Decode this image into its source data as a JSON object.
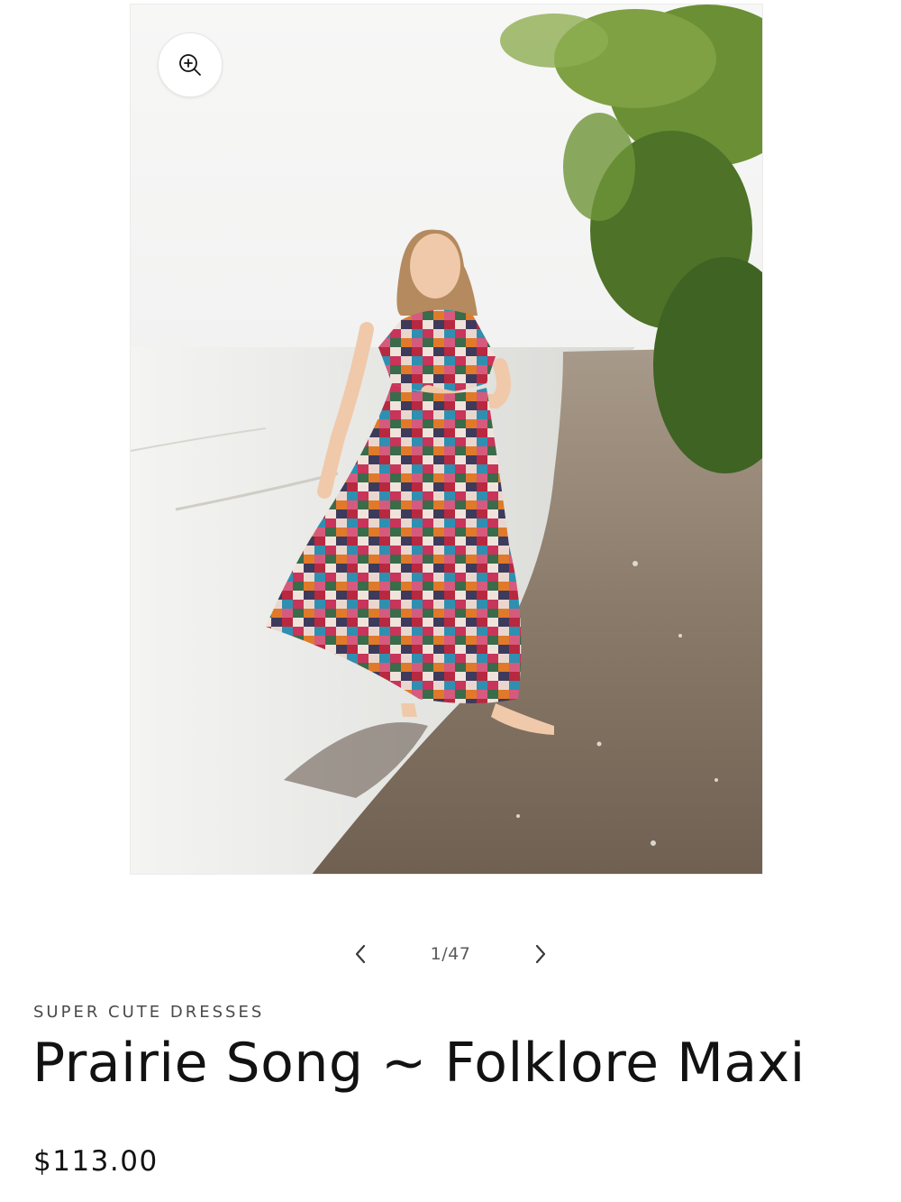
{
  "product": {
    "vendor": "SUPER CUTE DRESSES",
    "title": "Prairie Song ~ Folklore Maxi",
    "price": "$113.00"
  },
  "gallery": {
    "counter": "1/47",
    "current": 1,
    "total": 47,
    "image_alt": "Prairie Song ~ Folklore Maxi",
    "zoom_icon": "zoom-in-icon",
    "prev_icon": "chevron-left-icon",
    "next_icon": "chevron-right-icon"
  }
}
